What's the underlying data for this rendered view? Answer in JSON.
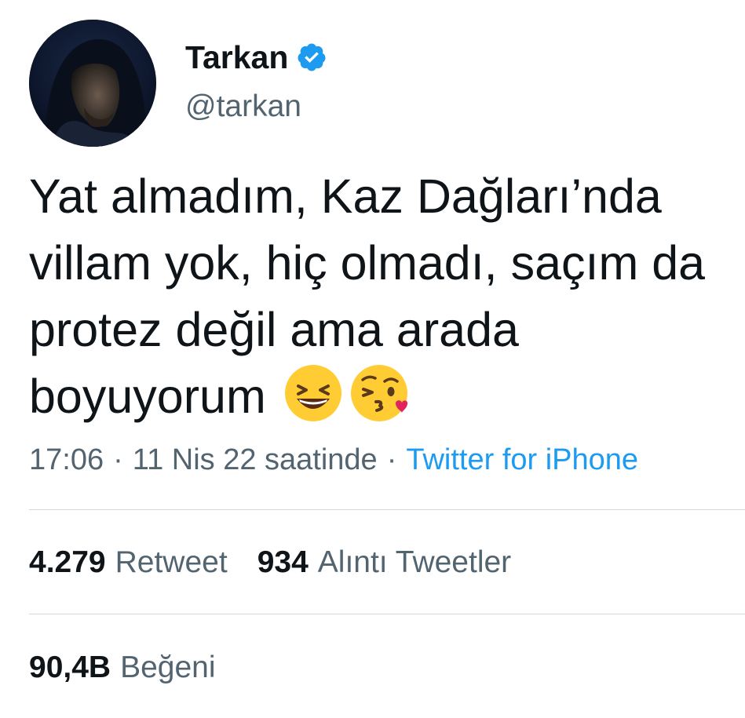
{
  "author": {
    "name": "Tarkan",
    "handle": "@tarkan",
    "verified_icon": "verified-badge-icon",
    "avatar": "hooded-man-avatar"
  },
  "tweet": {
    "lines": [
      "Yat almadım, Kaz Dağları’nda",
      "villam yok, hiç olmadı, saçım da",
      "protez değil ama arada",
      "boyuyorum"
    ],
    "emojis": [
      "grinning-squinting-face-emoji",
      "face-blowing-kiss-emoji"
    ]
  },
  "meta": {
    "time": "17:06",
    "date": "11 Nis 22 saatinde",
    "separator": "·",
    "source": "Twitter for iPhone"
  },
  "stats": {
    "retweets": {
      "count": "4.279",
      "label": "Retweet"
    },
    "quotes": {
      "count": "934",
      "label": "Alıntı Tweetler"
    },
    "likes": {
      "count": "90,4B",
      "label": "Beğeni"
    }
  },
  "colors": {
    "text_primary": "#0f1419",
    "text_secondary": "#536471",
    "link": "#1d9bf0",
    "divider": "#cfd9de",
    "verified": "#1d9bf0"
  }
}
